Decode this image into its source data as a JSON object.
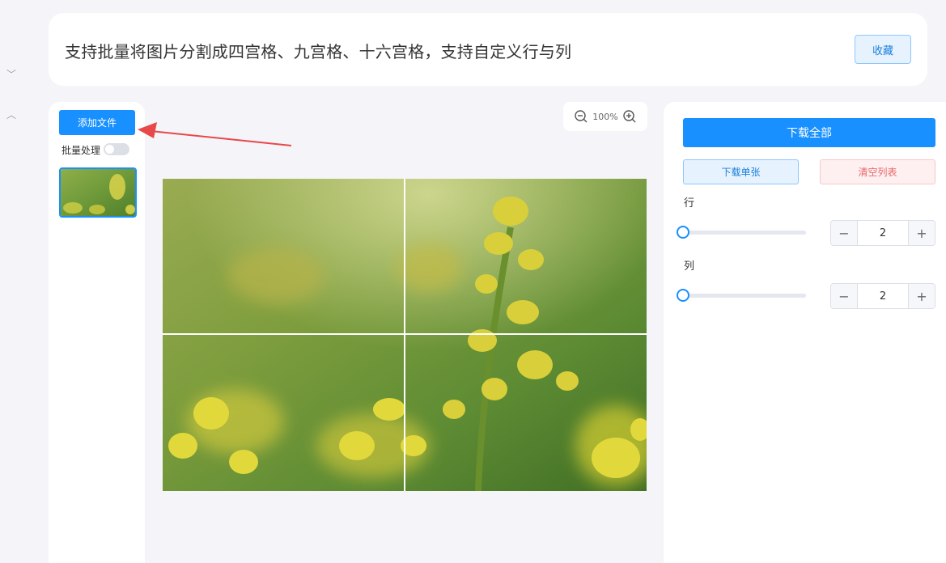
{
  "header": {
    "title": "支持批量将图片分割成四宫格、九宫格、十六宫格，支持自定义行与列",
    "favorite_label": "收藏"
  },
  "left_panel": {
    "add_file_label": "添加文件",
    "batch_label": "批量处理",
    "batch_enabled": false
  },
  "zoom": {
    "value": "100%",
    "zoom_out_icon": "zoom-out-icon",
    "zoom_in_icon": "zoom-in-icon"
  },
  "right_panel": {
    "download_all_label": "下载全部",
    "download_one_label": "下载单张",
    "clear_list_label": "清空列表",
    "rows_label": "行",
    "rows_value": "2",
    "cols_label": "列",
    "cols_value": "2"
  },
  "colors": {
    "primary": "#1890ff",
    "danger_text": "#e8686b",
    "arrow": "#e8484a"
  }
}
